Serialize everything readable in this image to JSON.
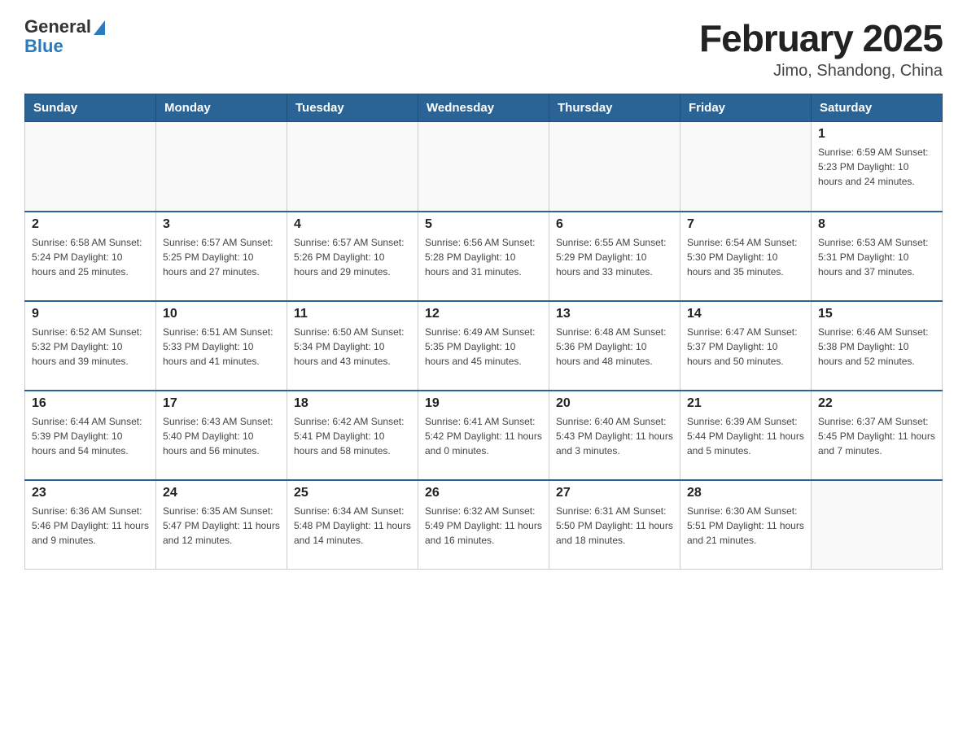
{
  "header": {
    "logo": {
      "general": "General",
      "blue": "Blue"
    },
    "title": "February 2025",
    "location": "Jimo, Shandong, China"
  },
  "weekdays": [
    "Sunday",
    "Monday",
    "Tuesday",
    "Wednesday",
    "Thursday",
    "Friday",
    "Saturday"
  ],
  "weeks": [
    [
      {
        "day": "",
        "info": ""
      },
      {
        "day": "",
        "info": ""
      },
      {
        "day": "",
        "info": ""
      },
      {
        "day": "",
        "info": ""
      },
      {
        "day": "",
        "info": ""
      },
      {
        "day": "",
        "info": ""
      },
      {
        "day": "1",
        "info": "Sunrise: 6:59 AM\nSunset: 5:23 PM\nDaylight: 10 hours\nand 24 minutes."
      }
    ],
    [
      {
        "day": "2",
        "info": "Sunrise: 6:58 AM\nSunset: 5:24 PM\nDaylight: 10 hours\nand 25 minutes."
      },
      {
        "day": "3",
        "info": "Sunrise: 6:57 AM\nSunset: 5:25 PM\nDaylight: 10 hours\nand 27 minutes."
      },
      {
        "day": "4",
        "info": "Sunrise: 6:57 AM\nSunset: 5:26 PM\nDaylight: 10 hours\nand 29 minutes."
      },
      {
        "day": "5",
        "info": "Sunrise: 6:56 AM\nSunset: 5:28 PM\nDaylight: 10 hours\nand 31 minutes."
      },
      {
        "day": "6",
        "info": "Sunrise: 6:55 AM\nSunset: 5:29 PM\nDaylight: 10 hours\nand 33 minutes."
      },
      {
        "day": "7",
        "info": "Sunrise: 6:54 AM\nSunset: 5:30 PM\nDaylight: 10 hours\nand 35 minutes."
      },
      {
        "day": "8",
        "info": "Sunrise: 6:53 AM\nSunset: 5:31 PM\nDaylight: 10 hours\nand 37 minutes."
      }
    ],
    [
      {
        "day": "9",
        "info": "Sunrise: 6:52 AM\nSunset: 5:32 PM\nDaylight: 10 hours\nand 39 minutes."
      },
      {
        "day": "10",
        "info": "Sunrise: 6:51 AM\nSunset: 5:33 PM\nDaylight: 10 hours\nand 41 minutes."
      },
      {
        "day": "11",
        "info": "Sunrise: 6:50 AM\nSunset: 5:34 PM\nDaylight: 10 hours\nand 43 minutes."
      },
      {
        "day": "12",
        "info": "Sunrise: 6:49 AM\nSunset: 5:35 PM\nDaylight: 10 hours\nand 45 minutes."
      },
      {
        "day": "13",
        "info": "Sunrise: 6:48 AM\nSunset: 5:36 PM\nDaylight: 10 hours\nand 48 minutes."
      },
      {
        "day": "14",
        "info": "Sunrise: 6:47 AM\nSunset: 5:37 PM\nDaylight: 10 hours\nand 50 minutes."
      },
      {
        "day": "15",
        "info": "Sunrise: 6:46 AM\nSunset: 5:38 PM\nDaylight: 10 hours\nand 52 minutes."
      }
    ],
    [
      {
        "day": "16",
        "info": "Sunrise: 6:44 AM\nSunset: 5:39 PM\nDaylight: 10 hours\nand 54 minutes."
      },
      {
        "day": "17",
        "info": "Sunrise: 6:43 AM\nSunset: 5:40 PM\nDaylight: 10 hours\nand 56 minutes."
      },
      {
        "day": "18",
        "info": "Sunrise: 6:42 AM\nSunset: 5:41 PM\nDaylight: 10 hours\nand 58 minutes."
      },
      {
        "day": "19",
        "info": "Sunrise: 6:41 AM\nSunset: 5:42 PM\nDaylight: 11 hours\nand 0 minutes."
      },
      {
        "day": "20",
        "info": "Sunrise: 6:40 AM\nSunset: 5:43 PM\nDaylight: 11 hours\nand 3 minutes."
      },
      {
        "day": "21",
        "info": "Sunrise: 6:39 AM\nSunset: 5:44 PM\nDaylight: 11 hours\nand 5 minutes."
      },
      {
        "day": "22",
        "info": "Sunrise: 6:37 AM\nSunset: 5:45 PM\nDaylight: 11 hours\nand 7 minutes."
      }
    ],
    [
      {
        "day": "23",
        "info": "Sunrise: 6:36 AM\nSunset: 5:46 PM\nDaylight: 11 hours\nand 9 minutes."
      },
      {
        "day": "24",
        "info": "Sunrise: 6:35 AM\nSunset: 5:47 PM\nDaylight: 11 hours\nand 12 minutes."
      },
      {
        "day": "25",
        "info": "Sunrise: 6:34 AM\nSunset: 5:48 PM\nDaylight: 11 hours\nand 14 minutes."
      },
      {
        "day": "26",
        "info": "Sunrise: 6:32 AM\nSunset: 5:49 PM\nDaylight: 11 hours\nand 16 minutes."
      },
      {
        "day": "27",
        "info": "Sunrise: 6:31 AM\nSunset: 5:50 PM\nDaylight: 11 hours\nand 18 minutes."
      },
      {
        "day": "28",
        "info": "Sunrise: 6:30 AM\nSunset: 5:51 PM\nDaylight: 11 hours\nand 21 minutes."
      },
      {
        "day": "",
        "info": ""
      }
    ]
  ]
}
